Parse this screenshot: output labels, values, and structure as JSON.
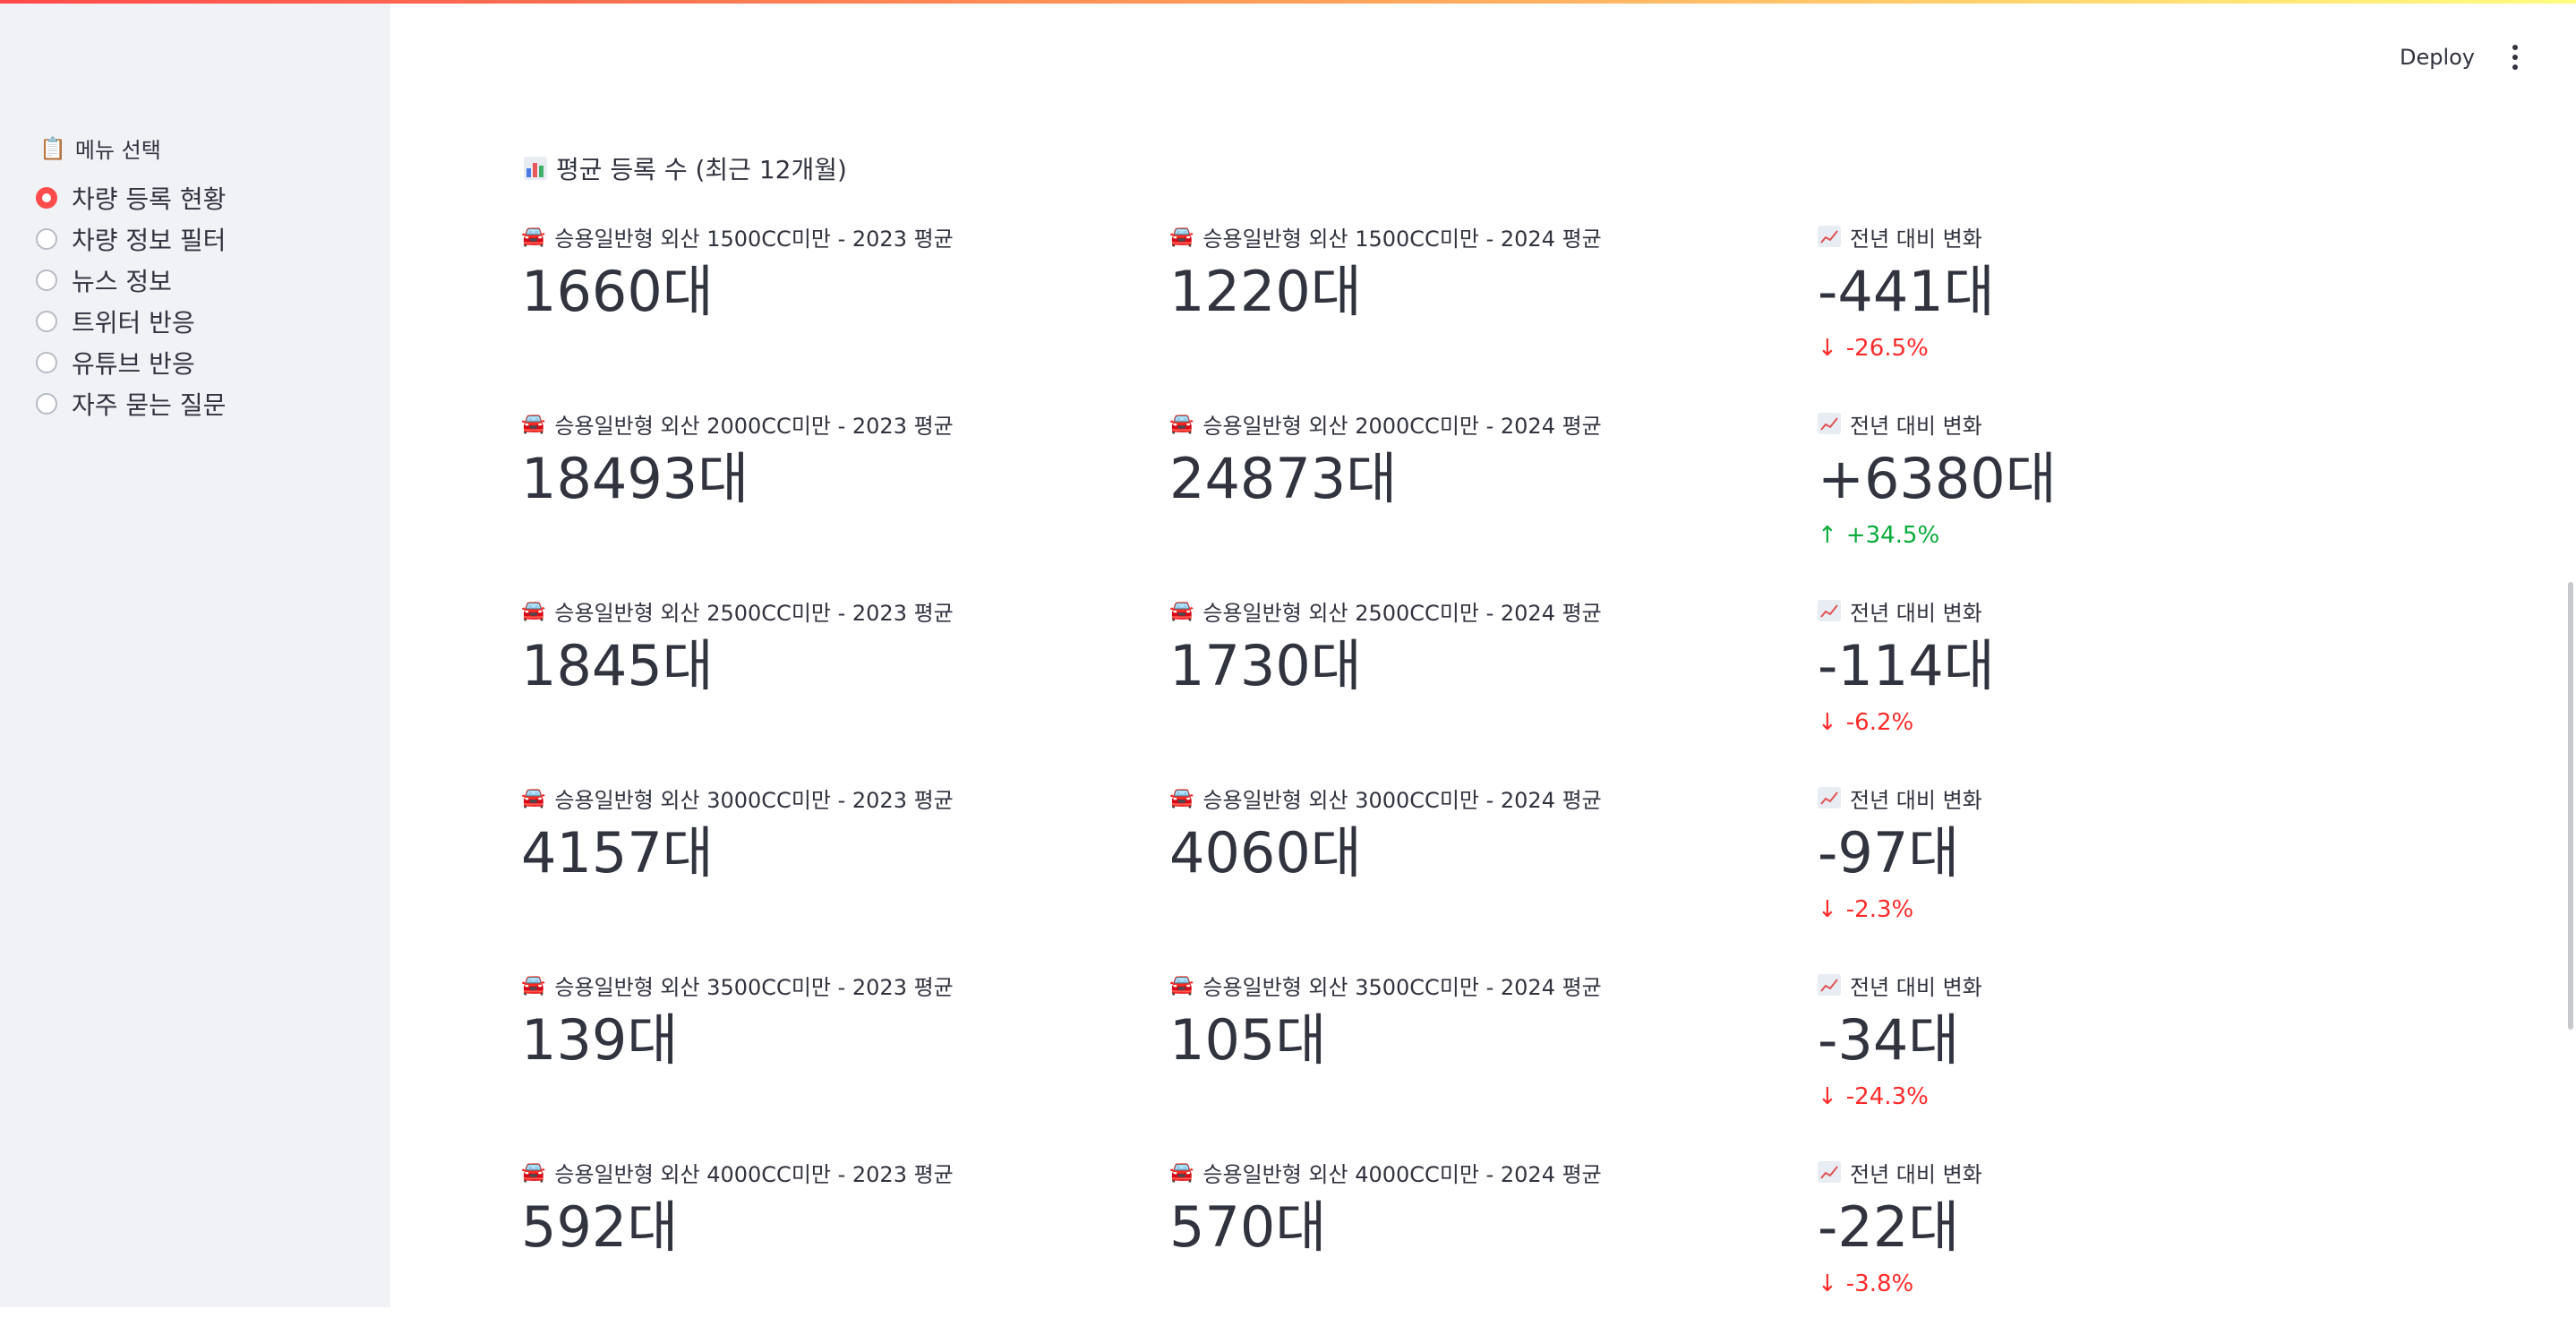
{
  "header": {
    "deploy_label": "Deploy"
  },
  "sidebar": {
    "title": "메뉴 선택",
    "options": [
      {
        "label": "차량 등록 현황",
        "selected": true
      },
      {
        "label": "차량 정보 필터",
        "selected": false
      },
      {
        "label": "뉴스 정보",
        "selected": false
      },
      {
        "label": "트위터 반응",
        "selected": false
      },
      {
        "label": "유튜브 반응",
        "selected": false
      },
      {
        "label": "자주 묻는 질문",
        "selected": false
      }
    ]
  },
  "main": {
    "section_title": "평균 등록 수 (최근 12개월)",
    "change_label": "전년 대비 변화",
    "rows": [
      {
        "label_2023": "승용일반형 외산 1500CC미만 - 2023 평균",
        "value_2023": "1660대",
        "label_2024": "승용일반형 외산 1500CC미만 - 2024 평균",
        "value_2024": "1220대",
        "change": "-441대",
        "delta": "-26.5%",
        "direction": "down"
      },
      {
        "label_2023": "승용일반형 외산 2000CC미만 - 2023 평균",
        "value_2023": "18493대",
        "label_2024": "승용일반형 외산 2000CC미만 - 2024 평균",
        "value_2024": "24873대",
        "change": "+6380대",
        "delta": "+34.5%",
        "direction": "up"
      },
      {
        "label_2023": "승용일반형 외산 2500CC미만 - 2023 평균",
        "value_2023": "1845대",
        "label_2024": "승용일반형 외산 2500CC미만 - 2024 평균",
        "value_2024": "1730대",
        "change": "-114대",
        "delta": "-6.2%",
        "direction": "down"
      },
      {
        "label_2023": "승용일반형 외산 3000CC미만 - 2023 평균",
        "value_2023": "4157대",
        "label_2024": "승용일반형 외산 3000CC미만 - 2024 평균",
        "value_2024": "4060대",
        "change": "-97대",
        "delta": "-2.3%",
        "direction": "down"
      },
      {
        "label_2023": "승용일반형 외산 3500CC미만 - 2023 평균",
        "value_2023": "139대",
        "label_2024": "승용일반형 외산 3500CC미만 - 2024 평균",
        "value_2024": "105대",
        "change": "-34대",
        "delta": "-24.3%",
        "direction": "down"
      },
      {
        "label_2023": "승용일반형 외산 4000CC미만 - 2023 평균",
        "value_2023": "592대",
        "label_2024": "승용일반형 외산 4000CC미만 - 2024 평균",
        "value_2024": "570대",
        "change": "-22대",
        "delta": "-3.8%",
        "direction": "down"
      }
    ]
  },
  "colors": {
    "accent": "#ff4b4b",
    "delta_down": "#ff2b2b",
    "delta_up": "#09ab3b",
    "sidebar_bg": "#f0f2f6",
    "text": "#31333f"
  },
  "icons": {
    "menu_title": "clipboard-icon",
    "section": "bar-chart-icon",
    "metric": "car-icon",
    "change": "chart-increasing-icon",
    "down": "arrow-down-icon",
    "up": "arrow-up-icon"
  }
}
